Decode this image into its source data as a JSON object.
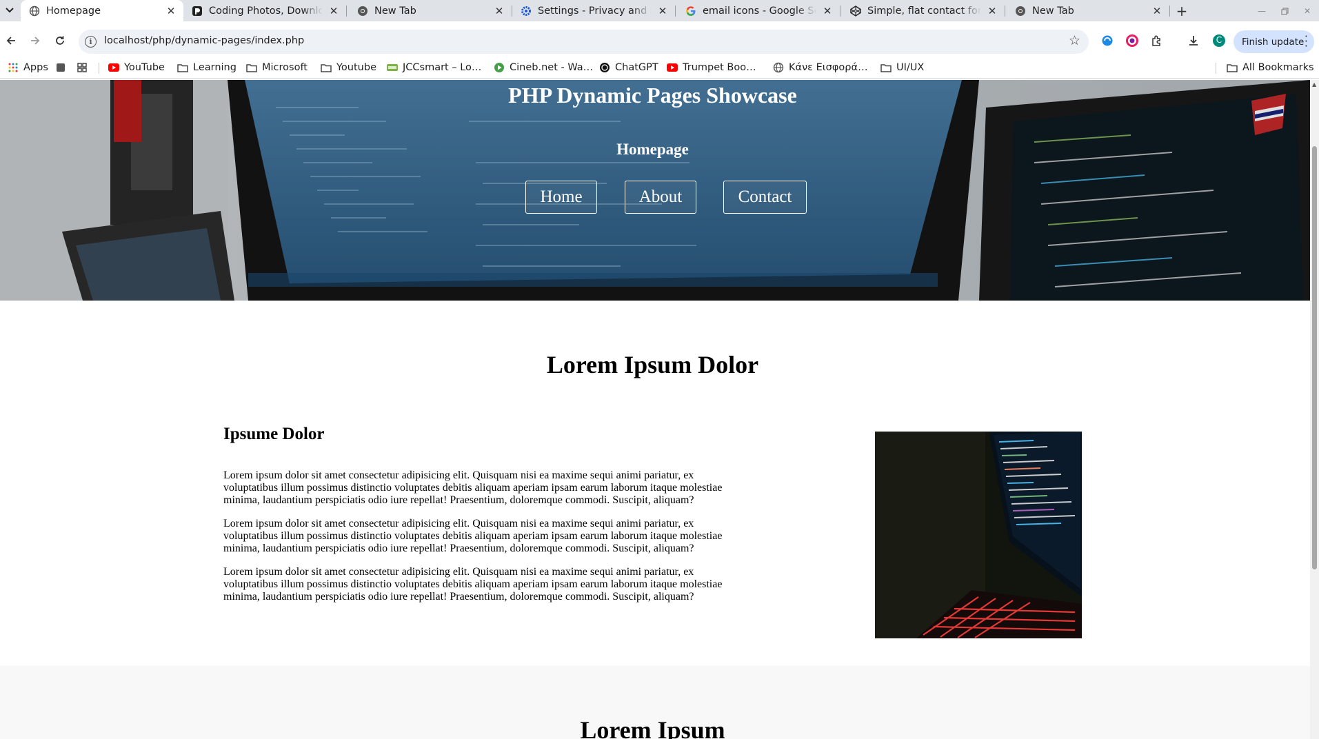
{
  "browser": {
    "tabs": [
      {
        "title": "Homepage",
        "icon": "globe-icon",
        "active": true
      },
      {
        "title": "Coding Photos, Downloa",
        "icon": "pexels-icon",
        "active": false
      },
      {
        "title": "New Tab",
        "icon": "chrome-icon",
        "active": false
      },
      {
        "title": "Settings - Privacy and sec",
        "icon": "settings-gear-icon",
        "active": false
      },
      {
        "title": "email icons - Google Sear",
        "icon": "google-icon",
        "active": false
      },
      {
        "title": "Simple, flat contact form",
        "icon": "codepen-icon",
        "active": false
      },
      {
        "title": "New Tab",
        "icon": "chrome-icon",
        "active": false
      }
    ],
    "url": "localhost/php/dynamic-pages/index.php",
    "finish_update_label": "Finish update",
    "profile_initial": "C",
    "bookmarks": [
      {
        "label": "Apps",
        "icon": "apps-grid-icon"
      },
      {
        "label": "",
        "icon": "extension-square-icon"
      },
      {
        "label": "",
        "icon": "dashboard-icon"
      },
      {
        "label": "YouTube",
        "icon": "youtube-icon"
      },
      {
        "label": "Learning",
        "icon": "folder-icon"
      },
      {
        "label": "Microsoft",
        "icon": "folder-icon"
      },
      {
        "label": "Youtube",
        "icon": "folder-icon"
      },
      {
        "label": "JCCsmart – Lo…",
        "icon": "jcc-icon"
      },
      {
        "label": "Cineb.net - Wa…",
        "icon": "play-circle-icon"
      },
      {
        "label": "ChatGPT",
        "icon": "chatgpt-icon"
      },
      {
        "label": "Trumpet Boo…",
        "icon": "youtube-icon"
      },
      {
        "label": "Κάνε Εισφορά…",
        "icon": "globe-icon"
      },
      {
        "label": "UI/UX",
        "icon": "folder-icon"
      }
    ],
    "all_bookmarks_label": "All Bookmarks"
  },
  "page": {
    "hero": {
      "title": "PHP Dynamic Pages Showcase",
      "subtitle": "Homepage",
      "nav": [
        "Home",
        "About",
        "Contact"
      ]
    },
    "section1": {
      "title": "Lorem Ipsum Dolor",
      "heading": "Ipsume Dolor",
      "paragraphs": [
        "Lorem ipsum dolor sit amet consectetur adipisicing elit. Quisquam nisi ea maxime sequi animi pariatur, ex voluptatibus illum possimus distinctio voluptates debitis aliquam aperiam ipsam earum laborum itaque molestiae minima, laudantium perspiciatis odio iure repellat! Praesentium, doloremque commodi. Suscipit, aliquam?",
        "Lorem ipsum dolor sit amet consectetur adipisicing elit. Quisquam nisi ea maxime sequi animi pariatur, ex voluptatibus illum possimus distinctio voluptates debitis aliquam aperiam ipsam earum laborum itaque molestiae minima, laudantium perspiciatis odio iure repellat! Praesentium, doloremque commodi. Suscipit, aliquam?",
        "Lorem ipsum dolor sit amet consectetur adipisicing elit. Quisquam nisi ea maxime sequi animi pariatur, ex voluptatibus illum possimus distinctio voluptates debitis aliquam aperiam ipsam earum laborum itaque molestiae minima, laudantium perspiciatis odio iure repellat! Praesentium, doloremque commodi. Suscipit, aliquam?"
      ]
    },
    "section2": {
      "title": "Lorem Ipsum"
    }
  }
}
